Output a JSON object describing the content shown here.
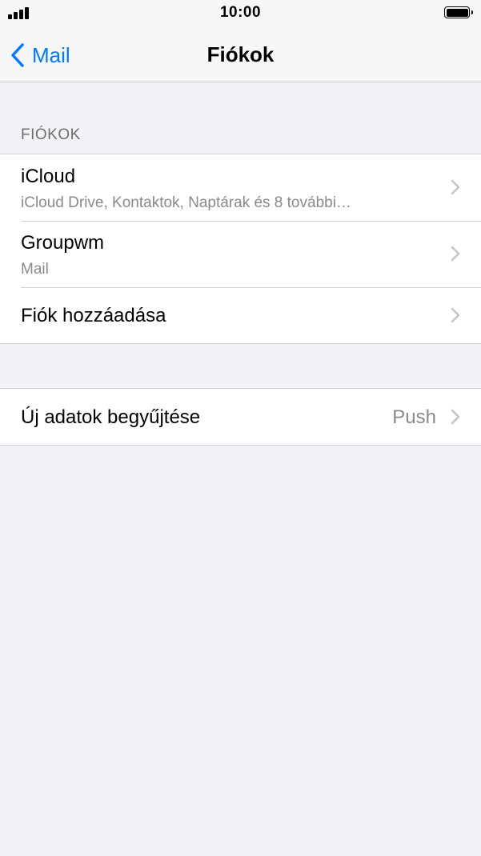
{
  "status_bar": {
    "time": "10:00"
  },
  "nav": {
    "back_label": "Mail",
    "title": "Fiókok"
  },
  "accounts_section": {
    "header": "FIÓKOK",
    "rows": [
      {
        "title": "iCloud",
        "subtitle": "iCloud Drive, Kontaktok, Naptárak és 8 további…"
      },
      {
        "title": "Groupwm",
        "subtitle": "Mail"
      },
      {
        "title": "Fiók hozzáadása"
      }
    ]
  },
  "fetch_section": {
    "rows": [
      {
        "title": "Új adatok begyűjtése",
        "value": "Push"
      }
    ]
  },
  "colors": {
    "accent": "#007aff",
    "background": "#f2f2f7",
    "secondary_text": "#8a8a8e"
  },
  "icons": [
    "signal-icon",
    "battery-icon",
    "back-chevron-icon",
    "chevron-right-icon"
  ]
}
